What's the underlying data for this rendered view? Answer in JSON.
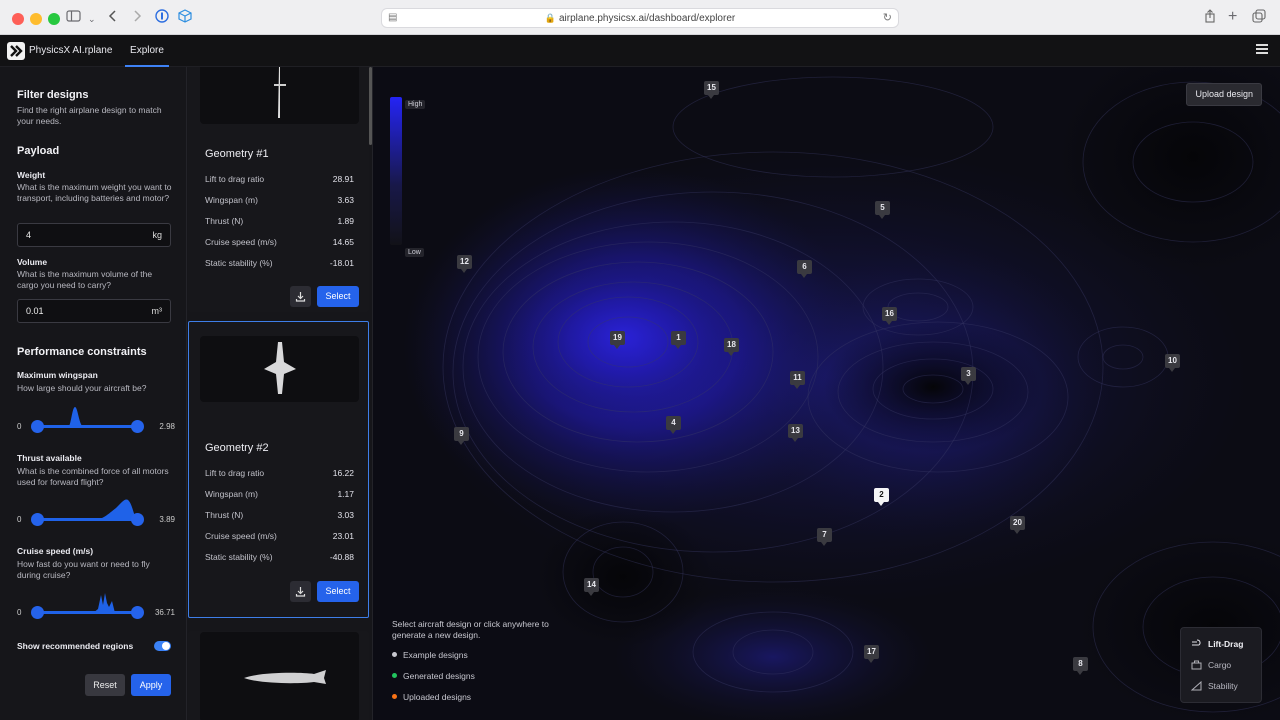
{
  "browser": {
    "url": "airplane.physicsx.ai/dashboard/explorer"
  },
  "app": {
    "brand": "PhysicsX AI.rplane",
    "nav_tab": "Explore"
  },
  "filters": {
    "title": "Filter designs",
    "subtitle": "Find the right airplane design to match your needs.",
    "payload_title": "Payload",
    "weight_label": "Weight",
    "weight_help": "What is the maximum weight you want to transport, including batteries and motor?",
    "weight_value": "4",
    "weight_unit": "kg",
    "volume_label": "Volume",
    "volume_help": "What is the maximum volume of the cargo you need to carry?",
    "volume_value": "0.01",
    "volume_unit": "m³",
    "perf_title": "Performance constraints",
    "wingspan_label": "Maximum wingspan",
    "wingspan_help": "How large should your aircraft be?",
    "wingspan_min": "0",
    "wingspan_max": "2.98",
    "thrust_label": "Thrust available",
    "thrust_help": "What is the combined force of all motors used for forward flight?",
    "thrust_min": "0",
    "thrust_max": "3.89",
    "cruise_label": "Cruise speed (m/s)",
    "cruise_help": "How fast do you want or need to fly during cruise?",
    "cruise_min": "0",
    "cruise_max": "36.71",
    "recommended_label": "Show recommended regions",
    "reset_label": "Reset",
    "apply_label": "Apply"
  },
  "geometries": [
    {
      "title": "Geometry #1",
      "specs": [
        {
          "label": "Lift to drag ratio",
          "value": "28.91"
        },
        {
          "label": "Wingspan (m)",
          "value": "3.63"
        },
        {
          "label": "Thrust (N)",
          "value": "1.89"
        },
        {
          "label": "Cruise speed (m/s)",
          "value": "14.65"
        },
        {
          "label": "Static stability (%)",
          "value": "-18.01"
        }
      ],
      "select_label": "Select"
    },
    {
      "title": "Geometry #2",
      "specs": [
        {
          "label": "Lift to drag ratio",
          "value": "16.22"
        },
        {
          "label": "Wingspan (m)",
          "value": "1.17"
        },
        {
          "label": "Thrust (N)",
          "value": "3.03"
        },
        {
          "label": "Cruise speed (m/s)",
          "value": "23.01"
        },
        {
          "label": "Static stability (%)",
          "value": "-40.88"
        }
      ],
      "select_label": "Select"
    }
  ],
  "map": {
    "legend_high": "High",
    "legend_low": "Low",
    "upload_label": "Upload design",
    "hint": "Select aircraft design or click anywhere to generate a new design.",
    "legend_items": [
      {
        "label": "Example designs",
        "color": "#c8c8d0"
      },
      {
        "label": "Generated designs",
        "color": "#22c55e"
      },
      {
        "label": "Uploaded designs",
        "color": "#f97316"
      }
    ],
    "modes": [
      "Lift-Drag",
      "Cargo",
      "Stability"
    ],
    "active_mode": "Lift-Drag",
    "active_marker": "2",
    "markers": [
      "1",
      "2",
      "3",
      "4",
      "5",
      "6",
      "7",
      "8",
      "9",
      "10",
      "11",
      "12",
      "13",
      "14",
      "15",
      "16",
      "17",
      "18",
      "19",
      "20"
    ]
  }
}
